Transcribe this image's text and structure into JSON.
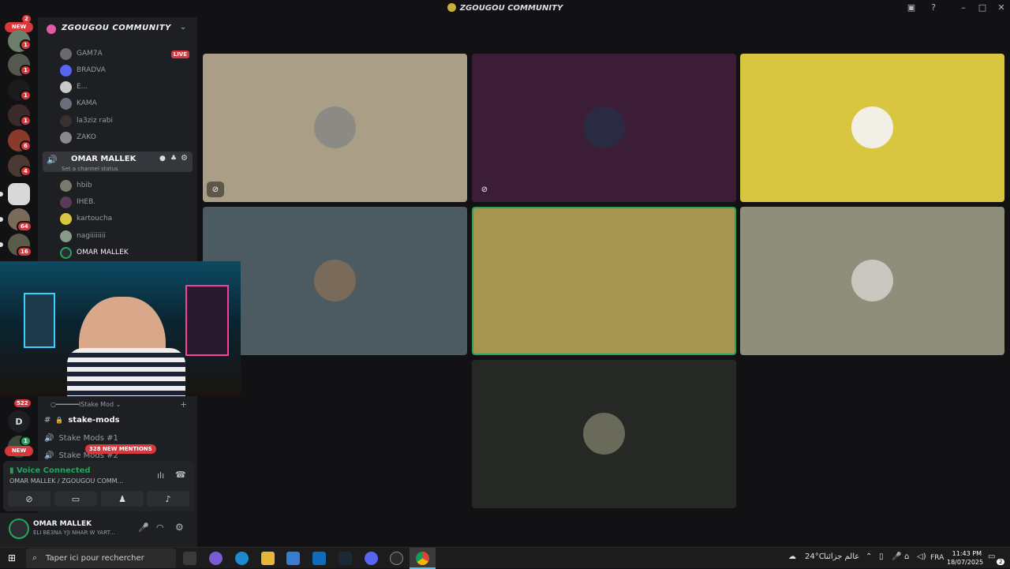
{
  "window": {
    "title": "ZGOUGOU COMMUNITY"
  },
  "rail": {
    "new_top": "NEW",
    "new_bottom": "NEW",
    "top_badge": "2",
    "badges": [
      "1",
      "1",
      "1",
      "1",
      "6",
      "4",
      "64",
      "16",
      "522",
      "1"
    ],
    "dm_letter": "D"
  },
  "sidebar": {
    "server_name": "ZGOUGOU COMMUNITY",
    "members_top": [
      "GAM7A",
      "BRADVA",
      "E...",
      "KAMA",
      "la3ziz rabi",
      "ZAKO"
    ],
    "live_label": "LIVE",
    "voice_channel": "OMAR MALLEK",
    "channel_status": "Set a channel status",
    "members_voice": [
      "hbib",
      "IHEB.",
      "kartoucha",
      "nagiiiiiiii",
      "OMAR MALLEK"
    ],
    "category": "IStake Mod",
    "channels": [
      "stake-mods",
      "Stake Mods #1",
      "Stake Mods #2"
    ],
    "mentions": "328 NEW MENTIONS"
  },
  "voice_panel": {
    "status": "Voice Connected",
    "location": "OMAR MALLEK / ZGOUGOU COMM..."
  },
  "user": {
    "name": "OMAR MALLEK",
    "status": "ELI BE3NA YJI NHAR W YART..."
  },
  "tiles": [
    {
      "bg": "#ab9e86",
      "muted": true
    },
    {
      "bg": "#3b1d37",
      "muted": true
    },
    {
      "bg": "#d9c640",
      "muted": false
    },
    {
      "bg": "#4c5b61",
      "muted": false
    },
    {
      "bg": "#a69451",
      "muted": false,
      "speaking": true
    },
    {
      "bg": "#8f8e7a",
      "muted": false
    },
    {
      "bg": "#252825",
      "muted": false
    }
  ],
  "taskbar": {
    "search_placeholder": "Taper ici pour rechercher",
    "weather": "24°C",
    "weather_text": "عالم جزائنا",
    "lang": "FRA",
    "time": "11:43 PM",
    "date": "18/07/2025",
    "notif_count": "2"
  }
}
